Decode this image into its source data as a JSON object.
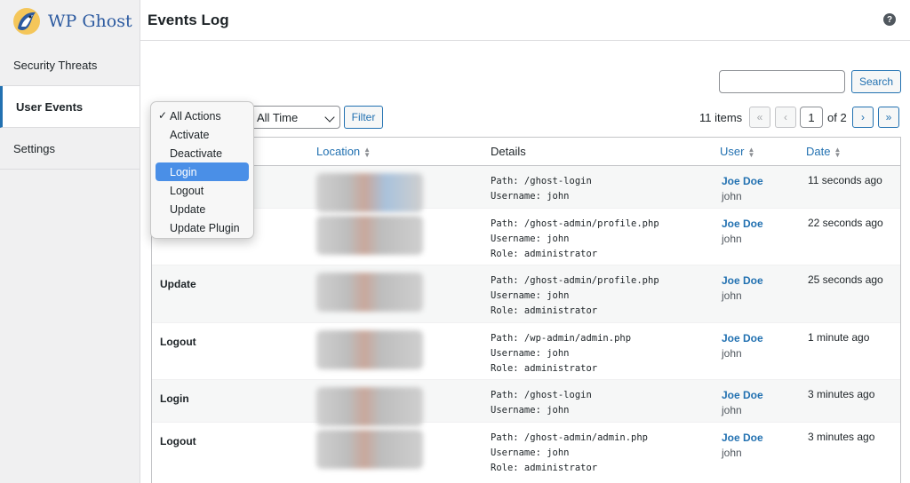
{
  "brand": {
    "name": "WP Ghost"
  },
  "sidebar": {
    "items": [
      {
        "label": "Security Threats",
        "active": false
      },
      {
        "label": "User Events",
        "active": true
      },
      {
        "label": "Settings",
        "active": false
      }
    ]
  },
  "header": {
    "title": "Events Log",
    "help_icon": "?"
  },
  "search": {
    "value": "",
    "button_label": "Search"
  },
  "filters": {
    "action_select": {
      "selected": "All Actions",
      "options": [
        "All Actions",
        "Activate",
        "Deactivate",
        "Login",
        "Logout",
        "Update",
        "Update Plugin"
      ],
      "highlighted": "Login"
    },
    "time_select": {
      "selected": "All Time"
    },
    "filter_button": "Filter"
  },
  "pagination": {
    "items_text": "11 items",
    "first": "«",
    "prev": "‹",
    "current": "1",
    "of_text": "of 2",
    "next": "›",
    "last": "»"
  },
  "table": {
    "columns": [
      "Location",
      "Details",
      "User",
      "Date"
    ],
    "rows": [
      {
        "action": "",
        "details": [
          "Path: /ghost-login",
          "Username: john"
        ],
        "user": "Joe Doe",
        "login": "john",
        "date": "11 seconds ago"
      },
      {
        "action": "",
        "details": [
          "Path: /ghost-admin/profile.php",
          "Username: john",
          "Role: administrator"
        ],
        "user": "Joe Doe",
        "login": "john",
        "date": "22 seconds ago"
      },
      {
        "action": "Update",
        "details": [
          "Path: /ghost-admin/profile.php",
          "Username: john",
          "Role: administrator"
        ],
        "user": "Joe Doe",
        "login": "john",
        "date": "25 seconds ago"
      },
      {
        "action": "Logout",
        "details": [
          "Path: /wp-admin/admin.php",
          "Username: john",
          "Role: administrator"
        ],
        "user": "Joe Doe",
        "login": "john",
        "date": "1 minute ago"
      },
      {
        "action": "Login",
        "details": [
          "Path: /ghost-login",
          "Username: john"
        ],
        "user": "Joe Doe",
        "login": "john",
        "date": "3 minutes ago"
      },
      {
        "action": "Logout",
        "details": [
          "Path: /ghost-admin/admin.php",
          "Username: john",
          "Role: administrator"
        ],
        "user": "Joe Doe",
        "login": "john",
        "date": "3 minutes ago"
      }
    ]
  },
  "colors": {
    "accent": "#2271b1",
    "highlight": "#4a8fe7",
    "brand": "#2c5aa0"
  }
}
